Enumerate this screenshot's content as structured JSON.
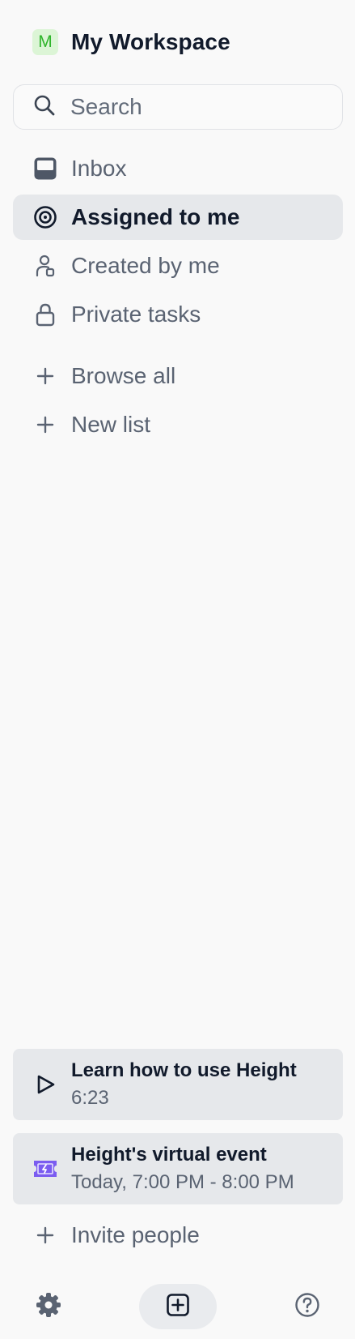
{
  "workspace": {
    "avatar_letter": "M",
    "name": "My Workspace"
  },
  "search": {
    "placeholder": "Search",
    "value": ""
  },
  "nav": {
    "inbox": "Inbox",
    "assigned": "Assigned to me",
    "created": "Created by me",
    "private": "Private tasks",
    "browse": "Browse all",
    "new_list": "New list"
  },
  "cards": {
    "learn": {
      "title": "Learn how to use Height",
      "subtitle": "6:23"
    },
    "event": {
      "title": "Height's virtual event",
      "subtitle": "Today, 7:00 PM - 8:00 PM"
    }
  },
  "invite": "Invite people",
  "colors": {
    "background": "#f9f9f9",
    "active_item": "#e6e8eb",
    "avatar_bg": "#dcf5d6",
    "avatar_fg": "#2fb52b",
    "event_icon": "#7b5cf0"
  },
  "icons": {
    "search": "search-icon",
    "inbox": "inbox-icon",
    "assigned": "target-icon",
    "created": "user-created-icon",
    "private": "lock-icon",
    "browse": "plus-icon",
    "new_list": "plus-icon",
    "learn": "play-icon",
    "event": "ticket-icon",
    "invite": "plus-icon",
    "settings": "gear-icon",
    "new_task": "plus-square-icon",
    "help": "help-icon"
  }
}
